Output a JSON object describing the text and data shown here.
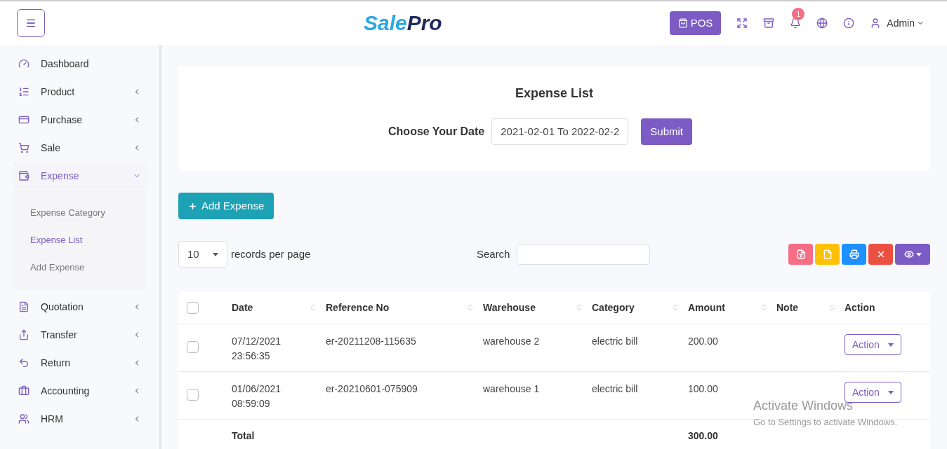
{
  "header": {
    "logo": [
      "Sale",
      "Pro"
    ],
    "pos_button": "POS",
    "notification_count": "1",
    "user": "Admin"
  },
  "sidebar": {
    "items": [
      {
        "label": "Dashboard"
      },
      {
        "label": "Product",
        "expanded": false
      },
      {
        "label": "Purchase",
        "expanded": false
      },
      {
        "label": "Sale",
        "expanded": false
      },
      {
        "label": "Expense",
        "expanded": true,
        "children": [
          {
            "label": "Expense Category",
            "selected": false
          },
          {
            "label": "Expense List",
            "selected": true
          },
          {
            "label": "Add Expense",
            "selected": false
          }
        ]
      },
      {
        "label": "Quotation",
        "expanded": false
      },
      {
        "label": "Transfer",
        "expanded": false
      },
      {
        "label": "Return",
        "expanded": false
      },
      {
        "label": "Accounting",
        "expanded": false
      },
      {
        "label": "HRM",
        "expanded": false
      }
    ]
  },
  "filter_card": {
    "title": "Expense List",
    "date_label": "Choose Your Date",
    "date_value": "2021-02-01 To 2022-02-2",
    "submit": "Submit"
  },
  "add_button": "Add Expense",
  "table_controls": {
    "page_size": "10",
    "page_size_label": "records per page",
    "search_label": "Search",
    "export_buttons": [
      {
        "kind": "pdf",
        "color": "#f56e85"
      },
      {
        "kind": "csv",
        "color": "#ffc107"
      },
      {
        "kind": "print",
        "color": "#1e90ff"
      },
      {
        "kind": "delete",
        "color": "#ec5040"
      },
      {
        "kind": "columns",
        "color": "#7c5cc4"
      }
    ]
  },
  "table": {
    "columns": [
      {
        "label": "Date",
        "sortable": true
      },
      {
        "label": "Reference No",
        "sortable": true
      },
      {
        "label": "Warehouse",
        "sortable": true
      },
      {
        "label": "Category",
        "sortable": true
      },
      {
        "label": "Amount",
        "sortable": true
      },
      {
        "label": "Note",
        "sortable": true
      },
      {
        "label": "Action",
        "sortable": false
      }
    ],
    "all_checked": false,
    "rows": [
      {
        "checked": false,
        "date": "07/12/2021",
        "time": "23:56:35",
        "reference": "er-20211208-115635",
        "warehouse": "warehouse 2",
        "category": "electric bill",
        "amount": "200.00",
        "action": "Action"
      },
      {
        "checked": false,
        "date": "01/06/2021",
        "time": "08:59:09",
        "reference": "er-20210601-075909",
        "warehouse": "warehouse 1",
        "category": "electric bill",
        "amount": "100.00",
        "action": "Action"
      }
    ],
    "total": {
      "label": "Total",
      "amount": "300.00"
    }
  },
  "os_notice": {
    "title": "Activate Windows",
    "subtitle": "Go to Settings to activate Windows."
  }
}
